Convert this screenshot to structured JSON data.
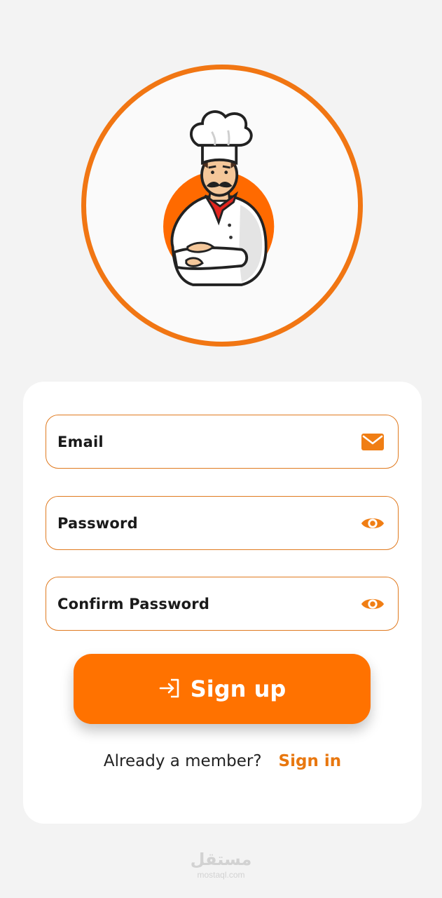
{
  "logo": {
    "icon": "chef-mascot-icon",
    "ring_color": "#f17613"
  },
  "form": {
    "email": {
      "placeholder": "Email",
      "icon": "mail-icon"
    },
    "password": {
      "placeholder": "Password",
      "icon": "eye-icon"
    },
    "confirm_password": {
      "placeholder": "Confirm Password",
      "icon": "eye-icon"
    }
  },
  "signup_button": {
    "label": "Sign up",
    "icon": "sign-in-arrow-icon",
    "color": "#ff7200"
  },
  "footer": {
    "member_text": "Already a member?",
    "signin_label": "Sign in",
    "accent": "#e8770f"
  },
  "watermark": {
    "arabic": "مستقل",
    "latin": "mostaql.com"
  }
}
